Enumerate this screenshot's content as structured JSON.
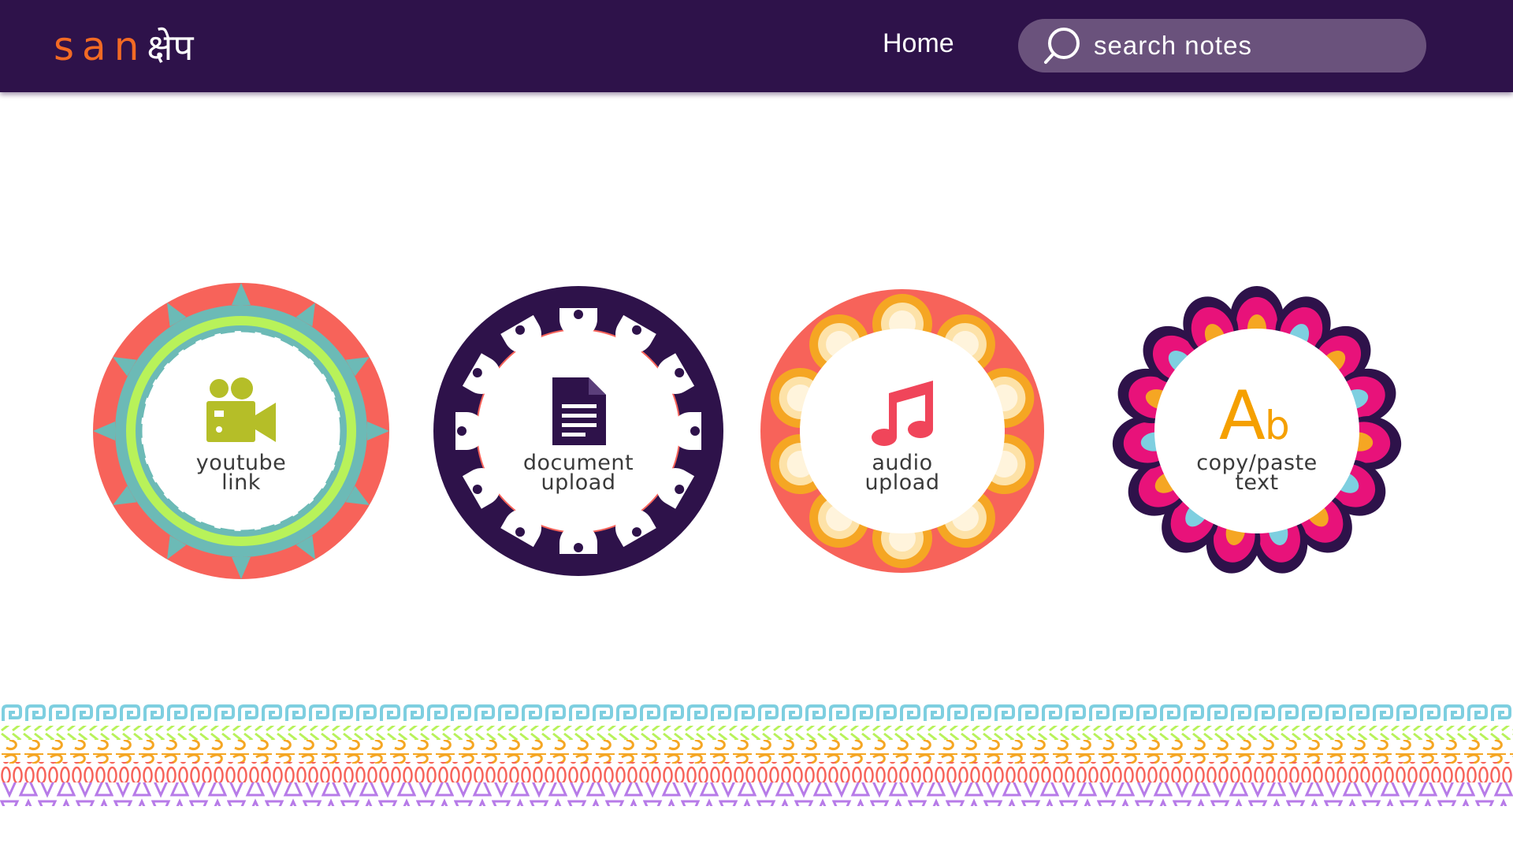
{
  "header": {
    "logo": {
      "latin": "san",
      "devanagari": "क्षेप"
    },
    "nav_home": "Home",
    "search": {
      "placeholder": "search notes",
      "value": ""
    }
  },
  "options": [
    {
      "id": "youtube",
      "line1": "youtube",
      "line2": "link",
      "icon": "video-camera-icon",
      "icon_color": "#b5be28"
    },
    {
      "id": "document",
      "line1": "document",
      "line2": "upload",
      "icon": "document-icon",
      "icon_color": "#2e124a"
    },
    {
      "id": "audio",
      "line1": "audio",
      "line2": "upload",
      "icon": "music-note-icon",
      "icon_color": "#f0455a"
    },
    {
      "id": "text",
      "line1": "copy/paste",
      "line2": "text",
      "icon": "text-ab-icon",
      "icon_color": "#f5a000"
    }
  ],
  "colors": {
    "nav_bg": "#2e124a",
    "logo_accent": "#f26a24",
    "search_bg": "#6a527c",
    "coral": "#f7635a",
    "teal": "#6cbab6",
    "lime": "#b8f25a",
    "pink": "#e8127a",
    "orange": "#f5a623",
    "cyan": "#7ecfe0",
    "purple_band": "#b77be8"
  }
}
